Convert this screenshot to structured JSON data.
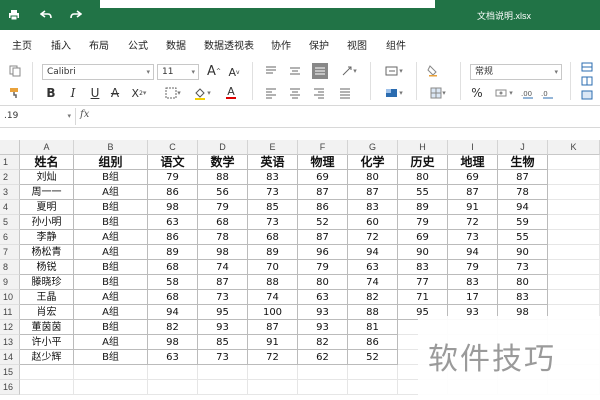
{
  "titlebar": {
    "filename": "文档说明.xlsx",
    "accent_color": "#217346"
  },
  "menu": {
    "tabs": [
      {
        "label": "主页",
        "active": true
      },
      {
        "label": "插入"
      },
      {
        "label": "布局"
      },
      {
        "label": "公式"
      },
      {
        "label": "数据"
      },
      {
        "label": "数据透视表"
      },
      {
        "label": "协作"
      },
      {
        "label": "保护"
      },
      {
        "label": "视图"
      },
      {
        "label": "组件"
      }
    ]
  },
  "ribbon": {
    "font_name": "Calibri",
    "font_size": "11",
    "grow_font": "A",
    "shrink_font": "A",
    "bold": "B",
    "italic": "I",
    "underline": "U",
    "strike": "A",
    "subscript": "X",
    "font_color_letter": "A",
    "number_format": "常规",
    "percent": "%"
  },
  "formula_bar": {
    "cell_ref": ".19",
    "fx": "fx"
  },
  "columns": [
    "A",
    "B",
    "C",
    "D",
    "E",
    "F",
    "G",
    "H",
    "I",
    "J",
    "K"
  ],
  "row_numbers": [
    "1",
    "2",
    "3",
    "4",
    "5",
    "6",
    "7",
    "8",
    "9",
    "10",
    "11",
    "12",
    "13",
    "14",
    "15",
    "16"
  ],
  "table": {
    "headers": [
      "姓名",
      "组别",
      "语文",
      "数学",
      "英语",
      "物理",
      "化学",
      "历史",
      "地理",
      "生物"
    ],
    "rows": [
      [
        "刘灿",
        "B组",
        "79",
        "88",
        "83",
        "69",
        "80",
        "80",
        "69",
        "87"
      ],
      [
        "周一一",
        "A组",
        "86",
        "56",
        "73",
        "87",
        "87",
        "55",
        "87",
        "78"
      ],
      [
        "夏明",
        "B组",
        "98",
        "79",
        "85",
        "86",
        "83",
        "89",
        "91",
        "94"
      ],
      [
        "孙小明",
        "B组",
        "63",
        "68",
        "73",
        "52",
        "60",
        "79",
        "72",
        "59"
      ],
      [
        "李静",
        "A组",
        "86",
        "78",
        "68",
        "87",
        "72",
        "69",
        "73",
        "55"
      ],
      [
        "杨松青",
        "A组",
        "89",
        "98",
        "89",
        "96",
        "94",
        "90",
        "94",
        "90"
      ],
      [
        "杨锐",
        "B组",
        "68",
        "74",
        "70",
        "79",
        "63",
        "83",
        "79",
        "73"
      ],
      [
        "滕晓珍",
        "B组",
        "58",
        "87",
        "88",
        "80",
        "74",
        "77",
        "83",
        "80"
      ],
      [
        "王晶",
        "A组",
        "68",
        "73",
        "74",
        "63",
        "82",
        "71",
        "17",
        "83"
      ],
      [
        "肖宏",
        "A组",
        "94",
        "95",
        "100",
        "93",
        "88",
        "95",
        "93",
        "98"
      ],
      [
        "董茵茵",
        "B组",
        "82",
        "93",
        "87",
        "93",
        "81",
        "",
        "",
        ""
      ],
      [
        "许小平",
        "A组",
        "98",
        "85",
        "91",
        "82",
        "86",
        "",
        "",
        ""
      ],
      [
        "赵少辉",
        "B组",
        "63",
        "73",
        "72",
        "62",
        "52",
        "",
        "",
        ""
      ]
    ]
  },
  "watermark": "软件技巧"
}
